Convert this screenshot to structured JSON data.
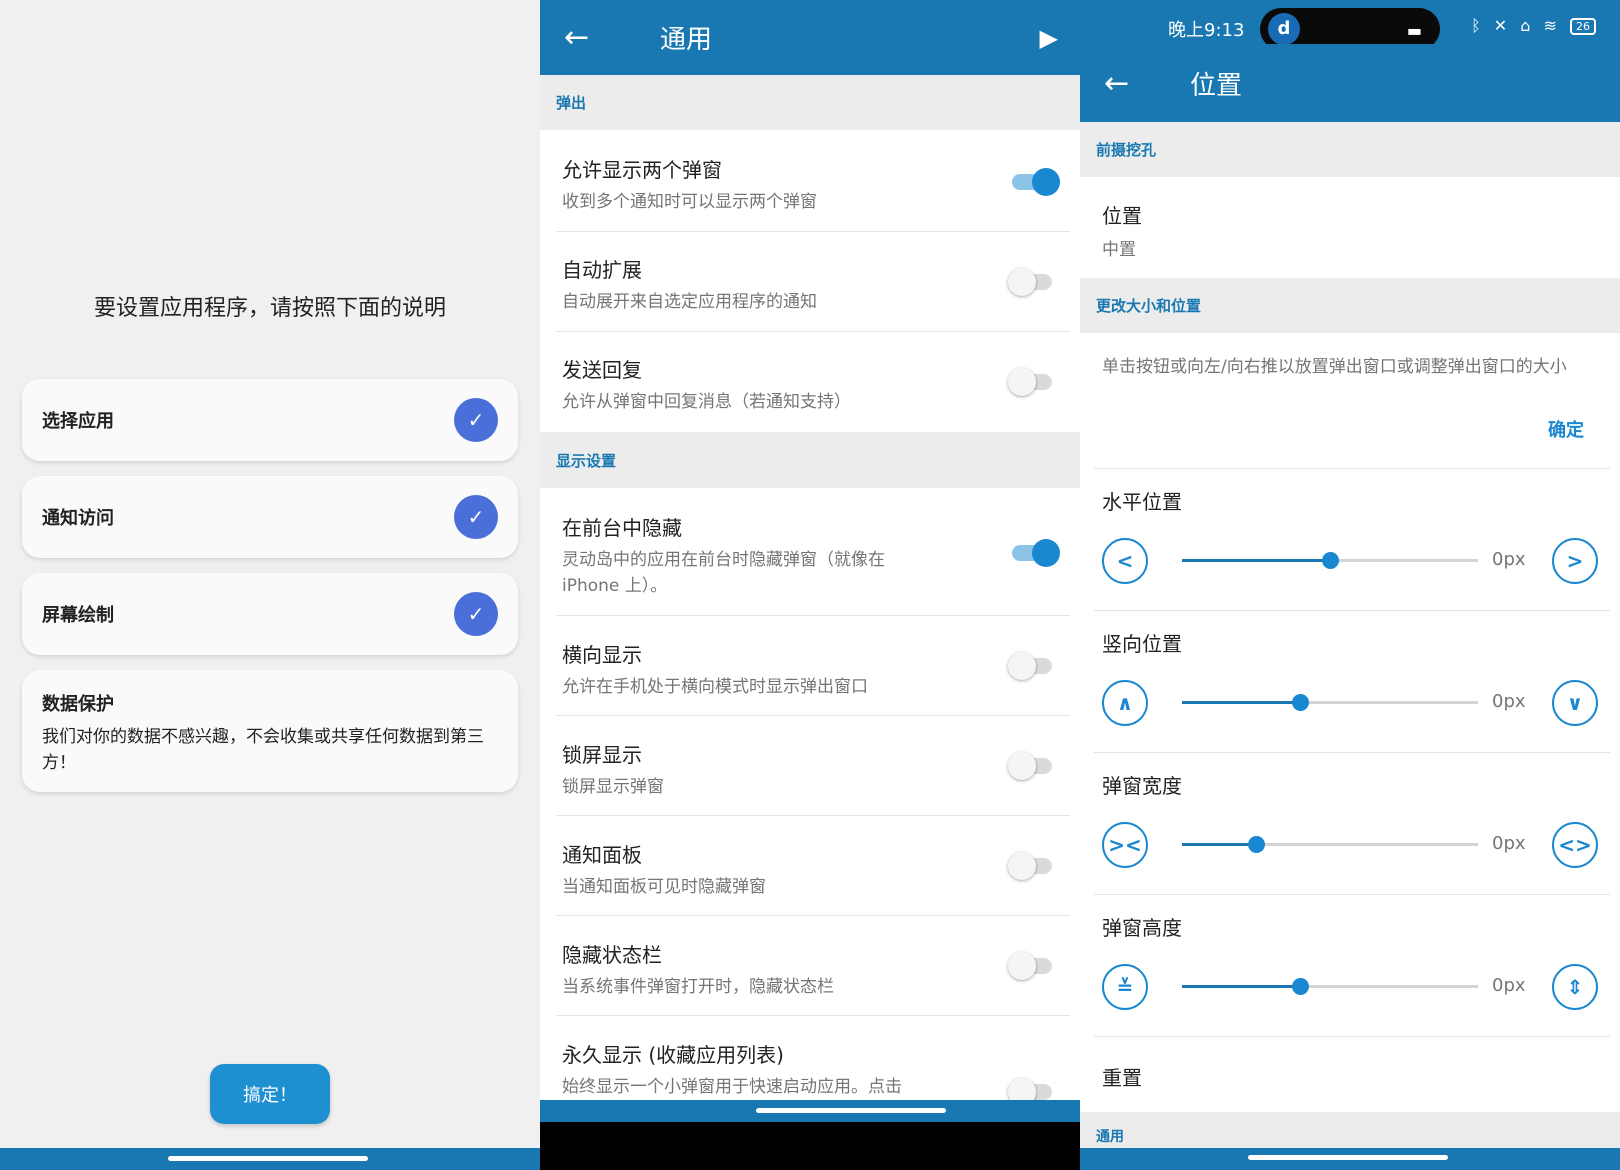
{
  "left": {
    "instruction": "要设置应用程序，请按照下面的说明",
    "steps": [
      {
        "label": "选择应用",
        "done": true
      },
      {
        "label": "通知访问",
        "done": true
      },
      {
        "label": "屏幕绘制",
        "done": true
      }
    ],
    "privacy": {
      "title": "数据保护",
      "text": "我们对你的数据不感兴趣，不会收集或共享任何数据到第三方！"
    },
    "done_button": "搞定！",
    "check_glyph": "✓"
  },
  "middle": {
    "title": "通用",
    "back_glyph": "←",
    "play_glyph": "▶",
    "sections": [
      {
        "header": "弹出"
      },
      {
        "header": "显示设置"
      }
    ],
    "settings": [
      {
        "title": "允许显示两个弹窗",
        "subtitle": "收到多个通知时可以显示两个弹窗",
        "on": true
      },
      {
        "title": "自动扩展",
        "subtitle": "自动展开来自选定应用程序的通知",
        "on": false
      },
      {
        "title": "发送回复",
        "subtitle": "允许从弹窗中回复消息（若通知支持）",
        "on": false
      },
      {
        "title": "在前台中隐藏",
        "subtitle": "灵动岛中的应用在前台时隐藏弹窗（就像在 iPhone 上）。",
        "on": true
      },
      {
        "title": "横向显示",
        "subtitle": "允许在手机处于横向模式时显示弹出窗口",
        "on": false
      },
      {
        "title": "锁屏显示",
        "subtitle": "锁屏显示弹窗",
        "on": false
      },
      {
        "title": "通知面板",
        "subtitle": "当通知面板可见时隐藏弹窗",
        "on": false
      },
      {
        "title": "隐藏状态栏",
        "subtitle": "当系统事件弹窗打开时，隐藏状态栏",
        "on": false
      },
      {
        "title": "永久显示 (收藏应用列表)",
        "subtitle": "始终显示一个小弹窗用于快速启动应用。点击",
        "on": false
      }
    ]
  },
  "right": {
    "status": {
      "time": "晚上9:13",
      "island_letter": "d",
      "icons": "ᛒ ✕ ⌂ ≋",
      "battery": "26"
    },
    "title": "位置",
    "back_glyph": "←",
    "section_cutout": "前摄挖孔",
    "position_title": "位置",
    "position_value": "中置",
    "section_resize": "更改大小和位置",
    "description": "单击按钮或向左/向右推以放置弹出窗口或调整弹出窗口的大小",
    "confirm": "确定",
    "sliders": [
      {
        "label": "水平位置",
        "value_text": "0px",
        "fraction": 0.5,
        "left_glyph": "<",
        "right_glyph": ">"
      },
      {
        "label": "竖向位置",
        "value_text": "0px",
        "fraction": 0.4,
        "left_glyph": "∧",
        "right_glyph": "∨"
      },
      {
        "label": "弹窗宽度",
        "value_text": "0px",
        "fraction": 0.25,
        "left_glyph": "><",
        "right_glyph": "<>"
      },
      {
        "label": "弹窗高度",
        "value_text": "0px",
        "fraction": 0.4,
        "left_glyph": "≚",
        "right_glyph": "⇕"
      }
    ],
    "reset": "重置",
    "section_general": "通用"
  }
}
